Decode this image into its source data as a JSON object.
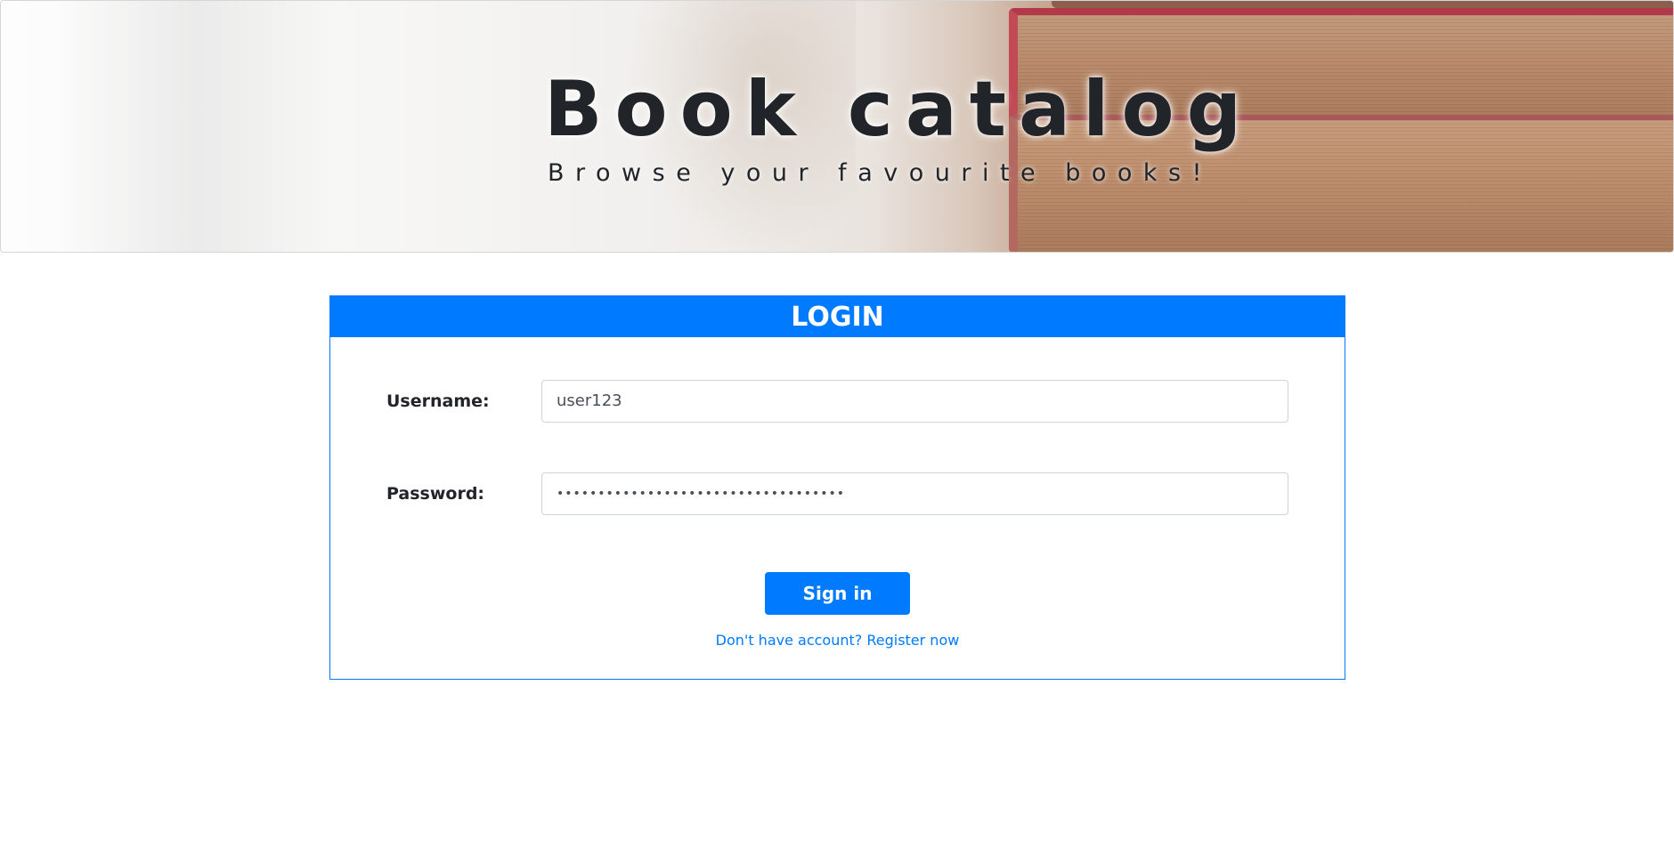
{
  "banner": {
    "title": "Book catalog",
    "subtitle": "Browse your favourite books!"
  },
  "login": {
    "header": "LOGIN",
    "username_label": "Username:",
    "username_value": "user123",
    "password_label": "Password:",
    "password_value": "•••••••••••••••••••••••••••••••••••",
    "signin_label": "Sign in",
    "register_text": "Don't have account? Register now"
  },
  "colors": {
    "accent": "#007bff",
    "text": "#212529",
    "input_border": "#ced4da"
  }
}
